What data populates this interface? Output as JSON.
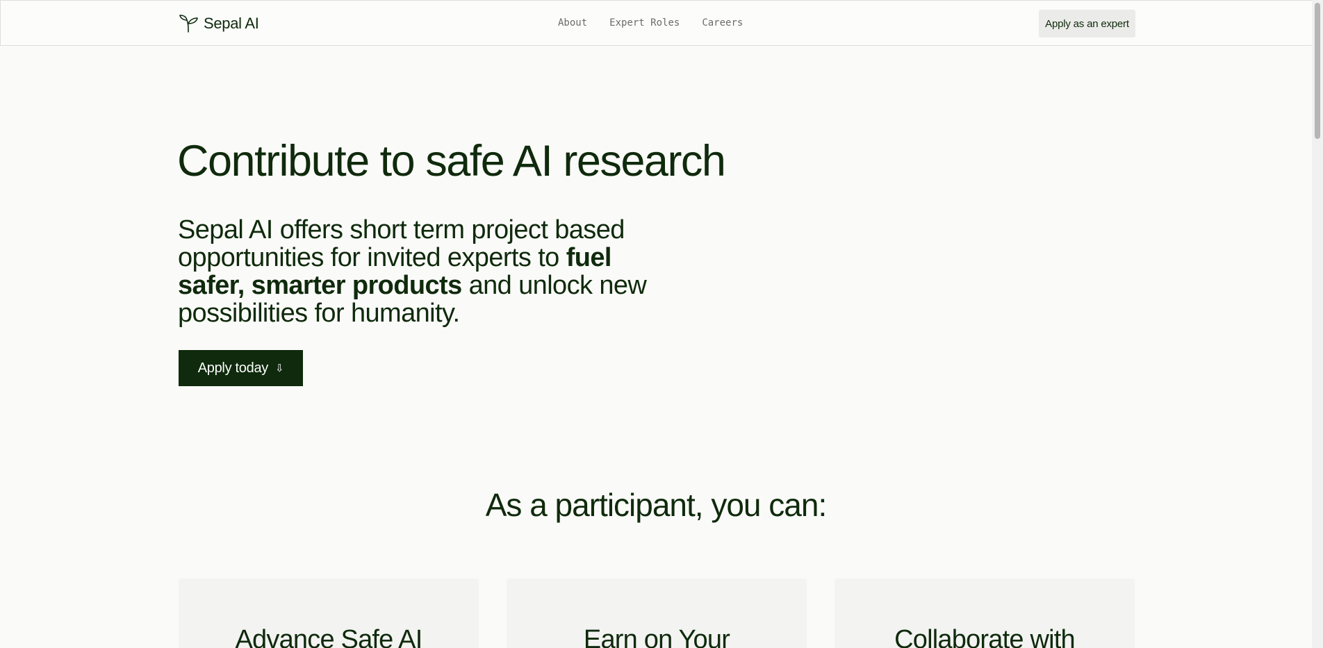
{
  "header": {
    "brand_name": "Sepal AI",
    "brand_icon": "sprout-icon",
    "nav": [
      {
        "label": "About"
      },
      {
        "label": "Expert Roles"
      },
      {
        "label": "Careers"
      }
    ],
    "cta_label": "Apply as an expert"
  },
  "hero": {
    "title": "Contribute to safe AI research",
    "description_part1": "Sepal AI offers short term project based opportunities for invited experts to ",
    "description_bold": "fuel safer, smarter products",
    "description_part2": " and unlock new possibilities for humanity.",
    "apply_label": "Apply today",
    "apply_icon": "arrow-down-icon",
    "apply_icon_glyph": "⇩"
  },
  "participant": {
    "title": "As a participant, you can:",
    "cards": [
      {
        "title": "Advance Safe AI"
      },
      {
        "title": "Earn on Your"
      },
      {
        "title": "Collaborate with"
      }
    ]
  },
  "colors": {
    "brand_dark_green": "#0f2a0c",
    "background": "#fafaf8",
    "card_background": "#f3f3f2",
    "nav_text": "#6b6b6b"
  }
}
